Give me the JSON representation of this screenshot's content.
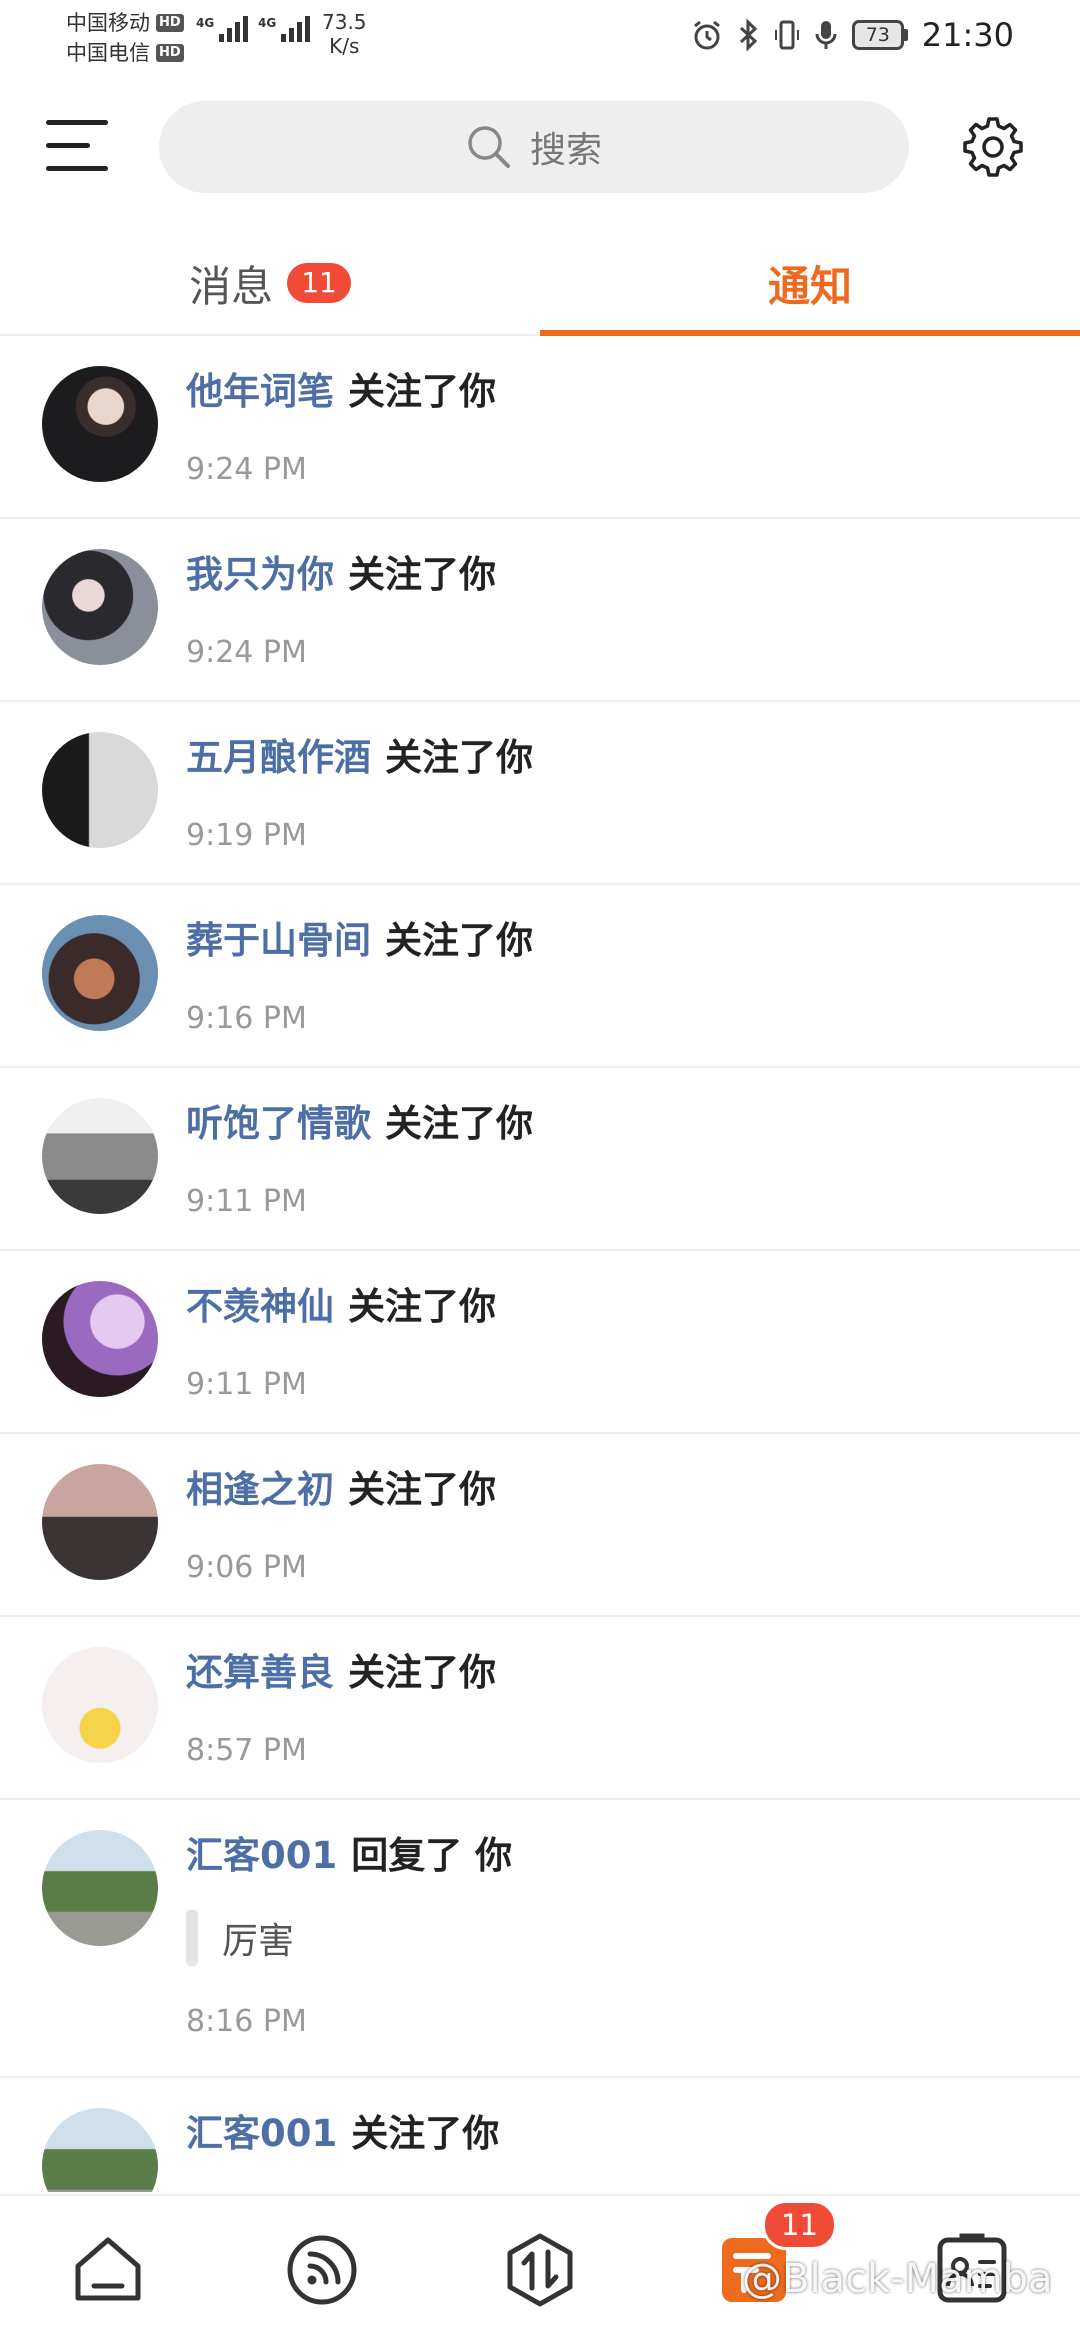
{
  "status_bar": {
    "carrier1": "中国移动",
    "carrier2": "中国电信",
    "hd": "HD",
    "network": "4G",
    "speed_value": "73.5",
    "speed_unit": "K/s",
    "battery": "73",
    "time": "21:30"
  },
  "header": {
    "search_placeholder": "搜索"
  },
  "tabs": {
    "messages_label": "消息",
    "messages_badge": "11",
    "notices_label": "通知"
  },
  "notifications": [
    {
      "user": "他年词笔",
      "action": "关注了你",
      "time": "9:24 PM"
    },
    {
      "user": "我只为你",
      "action": "关注了你",
      "time": "9:24 PM"
    },
    {
      "user": "五月酿作酒",
      "action": "关注了你",
      "time": "9:19 PM"
    },
    {
      "user": "葬于山骨间",
      "action": "关注了你",
      "time": "9:16 PM"
    },
    {
      "user": "听饱了情歌",
      "action": "关注了你",
      "time": "9:11 PM"
    },
    {
      "user": "不羡神仙",
      "action": "关注了你",
      "time": "9:11 PM"
    },
    {
      "user": "相逢之初",
      "action": "关注了你",
      "time": "9:06 PM"
    },
    {
      "user": "还算善良",
      "action": "关注了你",
      "time": "8:57 PM"
    },
    {
      "user": "汇客001",
      "action": "回复了 你",
      "reply": "厉害",
      "time": "8:16 PM"
    },
    {
      "user": "汇客001",
      "action": "关注了你"
    }
  ],
  "bottom_nav": {
    "badge": "11",
    "items": [
      "home-icon",
      "feed-icon",
      "exchange-icon",
      "notification-icon",
      "profile-card-icon"
    ],
    "active_color": "#ee6a1f"
  },
  "watermark": "@Black-Mamba",
  "colors": {
    "accent": "#ee6a1f",
    "username": "#4e6fa6",
    "badge": "#f04b36"
  }
}
